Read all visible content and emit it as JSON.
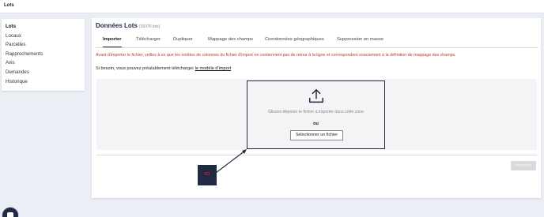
{
  "app": {
    "title": "Lots"
  },
  "sidebar": {
    "items": [
      {
        "label": "Lots",
        "active": true
      },
      {
        "label": "Locaux"
      },
      {
        "label": "Parcelles"
      },
      {
        "label": "Rapprochements"
      },
      {
        "label": "Avis"
      },
      {
        "label": "Demandes"
      },
      {
        "label": "Historique"
      }
    ]
  },
  "main": {
    "title": "Données Lots",
    "count": "(39376 lots)",
    "tabs": [
      {
        "label": "Importer",
        "active": true
      },
      {
        "label": "Télécharger"
      },
      {
        "label": "Dupliquer"
      },
      {
        "label": "Mappage des champs"
      },
      {
        "label": "Coordonnées géographiques"
      },
      {
        "label": "Suppression en masse"
      }
    ],
    "warning": "Avant d'importer le fichier, veillez à ce que les entêtes de colonnes du fichier d'import ne contiennent pas de retour à la ligne et correspondent exactement à la définition de mappage des champs.",
    "hint_prefix": "Si besoin, vous pouvez préalablement télécharger ",
    "hint_link": "le modèle d'import",
    "dropzone": {
      "icon": "upload-icon",
      "text": "Glissez-déposer le fichier à importer dans cette zone",
      "or": "ou",
      "select_button": "Sélectionner un fichier"
    },
    "import_button": "Importer"
  },
  "annotation": {
    "label": "ICI"
  },
  "colors": {
    "accent": "#1f2a44",
    "warning": "#c0392b",
    "annotation_text": "#e01b1b"
  }
}
